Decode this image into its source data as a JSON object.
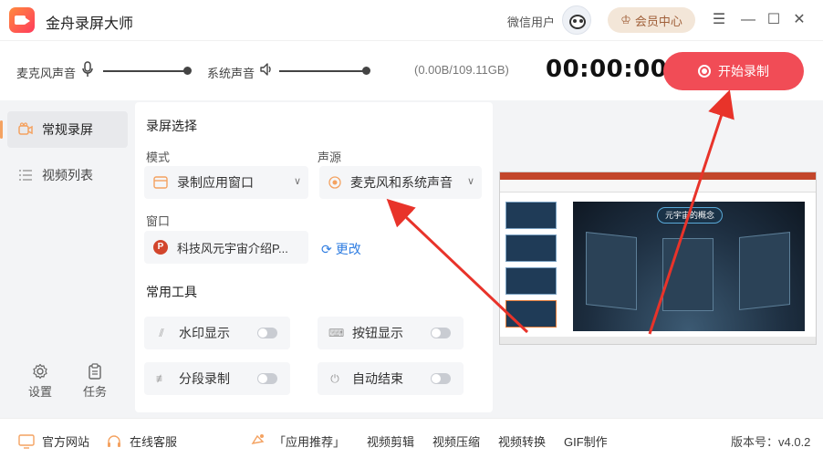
{
  "app": {
    "title": "金舟录屏大师",
    "user_name": "微信用户",
    "vip_label": "会员中心"
  },
  "audio": {
    "mic_label": "麦克风声音",
    "system_label": "系统声音",
    "storage": "(0.00B/109.11GB)",
    "timer": "00:00:00",
    "start_label": "开始录制"
  },
  "sidebar": {
    "items": [
      {
        "label": "常规录屏"
      },
      {
        "label": "视频列表"
      }
    ],
    "settings_label": "设置",
    "tasks_label": "任务"
  },
  "main": {
    "section_title": "录屏选择",
    "mode_label": "模式",
    "mode_value": "录制应用窗口",
    "source_label": "声源",
    "source_value": "麦克风和系统声音",
    "window_label": "窗口",
    "window_value": "科技风元宇宙介绍P...",
    "change_label": "更改",
    "tools_title": "常用工具",
    "tools": [
      {
        "label": "水印显示"
      },
      {
        "label": "按钮显示"
      },
      {
        "label": "分段录制"
      },
      {
        "label": "自动结束"
      }
    ]
  },
  "preview": {
    "slide_title": "元宇宙的概念"
  },
  "footer": {
    "website": "官方网站",
    "support": "在线客服",
    "recommend": "「应用推荐」",
    "links": [
      "视频剪辑",
      "视频压缩",
      "视频转换",
      "GIF制作"
    ],
    "version": "版本号：v4.0.2"
  },
  "colors": {
    "accent": "#f14c56",
    "sidebar_active": "#f4a261",
    "vip_bg": "#f3e6d8",
    "link": "#2f7de1"
  }
}
